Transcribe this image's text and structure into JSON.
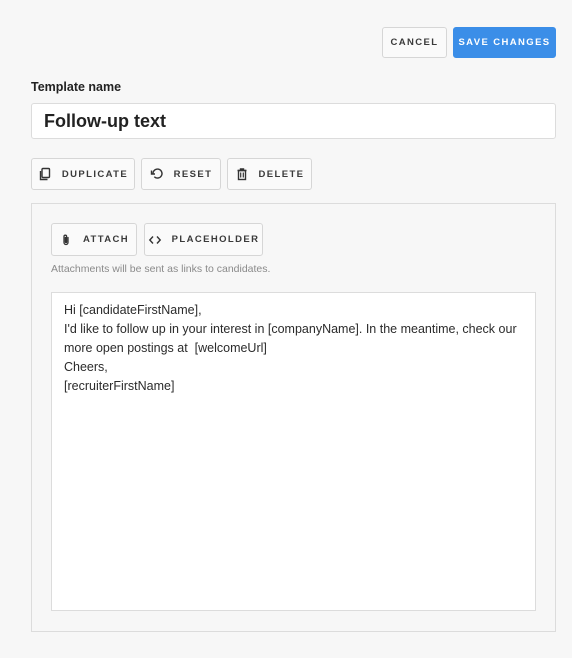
{
  "header": {
    "cancel_label": "CANCEL",
    "save_label": "SAVE CHANGES",
    "save_color": "#3b8ee8"
  },
  "template": {
    "name_label": "Template name",
    "name_value": "Follow-up text"
  },
  "actions": {
    "duplicate": {
      "label": "DUPLICATE",
      "icon": "copy-icon"
    },
    "reset": {
      "label": "RESET",
      "icon": "undo-icon"
    },
    "delete": {
      "label": "DELETE",
      "icon": "trash-icon"
    }
  },
  "editor": {
    "attach": {
      "label": "ATTACH",
      "icon": "paperclip-icon"
    },
    "placeholder": {
      "label": "PLACEHOLDER",
      "icon": "code-icon"
    },
    "hint": "Attachments will be sent as links to candidates.",
    "lines": [
      "Hi [candidateFirstName],",
      "I'd like to follow up in your interest in [companyName]. In the meantime, check our",
      "more open postings at  [welcomeUrl]",
      "Cheers,",
      "[recruiterFirstName]"
    ]
  }
}
